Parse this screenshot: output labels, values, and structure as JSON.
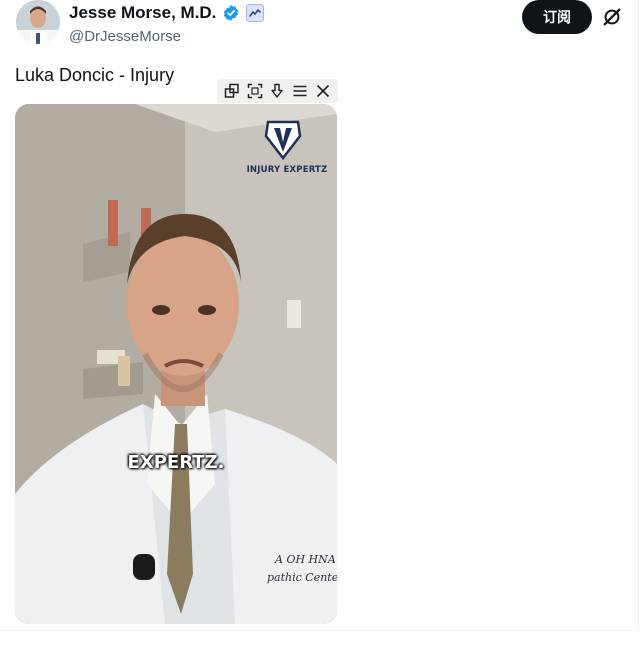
{
  "author": {
    "name": "Jesse Morse, M.D.",
    "handle": "@DrJesseMorse",
    "verified_icon": "verified-badge-icon",
    "affiliation_icon": "affiliation-badge-icon"
  },
  "actions": {
    "subscribe_label": "订阅",
    "grok_icon": "grok-icon"
  },
  "post": {
    "text": "Luka Doncic - Injury"
  },
  "video": {
    "watermark": "INJURY EXPERTZ",
    "caption": "EXPERTZ.",
    "coat_embroidery_line1": "A OH HNA",
    "coat_embroidery_line2": "pathic Center"
  },
  "pip_toolbar": {
    "icons": [
      "popout-icon",
      "fullscreen-icon",
      "download-icon",
      "menu-icon",
      "close-icon"
    ]
  },
  "colors": {
    "brand_dark": "#0f1419",
    "handle_gray": "#536471",
    "verified_blue": "#1d9bf0",
    "caption_white": "#ffffff"
  }
}
